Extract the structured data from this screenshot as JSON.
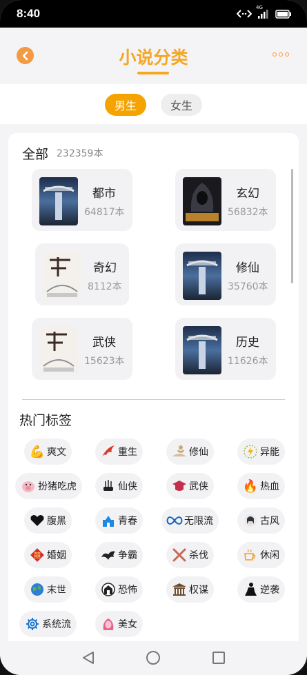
{
  "status_bar": {
    "time": "8:40",
    "network": "4G"
  },
  "header": {
    "title": "小说分类",
    "back_icon": "back-arrow-icon",
    "more_icon": "more-dots-icon"
  },
  "tabs": [
    {
      "label": "男生",
      "active": true
    },
    {
      "label": "女生",
      "active": false
    }
  ],
  "all_section": {
    "title": "全部",
    "count": "232359本"
  },
  "categories": [
    {
      "name": "都市",
      "count": "64817本",
      "cover": "blue-tower"
    },
    {
      "name": "玄幻",
      "count": "56832本",
      "cover": "dark-hooded"
    },
    {
      "name": "奇幻",
      "count": "8112本",
      "cover": "white-ink"
    },
    {
      "name": "修仙",
      "count": "35760本",
      "cover": "blue-tower"
    },
    {
      "name": "武侠",
      "count": "15623本",
      "cover": "white-ink"
    },
    {
      "name": "历史",
      "count": "11626本",
      "cover": "blue-tower"
    }
  ],
  "hot_tags_title": "热门标签",
  "hot_tags": [
    {
      "label": "爽文",
      "icon": "muscle-icon"
    },
    {
      "label": "重生",
      "icon": "phoenix-icon"
    },
    {
      "label": "修仙",
      "icon": "meditation-icon"
    },
    {
      "label": "异能",
      "icon": "energy-icon"
    },
    {
      "label": "扮猪吃虎",
      "icon": "pig-icon"
    },
    {
      "label": "仙侠",
      "icon": "incense-icon"
    },
    {
      "label": "武侠",
      "icon": "scholar-hat-icon"
    },
    {
      "label": "热血",
      "icon": "fire-icon"
    },
    {
      "label": "腹黑",
      "icon": "black-heart-icon"
    },
    {
      "label": "青春",
      "icon": "school-icon"
    },
    {
      "label": "无限流",
      "icon": "infinity-icon"
    },
    {
      "label": "古风",
      "icon": "ancient-figure-icon"
    },
    {
      "label": "婚姻",
      "icon": "double-happiness-icon"
    },
    {
      "label": "争霸",
      "icon": "dragon-icon"
    },
    {
      "label": "杀伐",
      "icon": "crossed-swords-icon"
    },
    {
      "label": "休闲",
      "icon": "coffee-icon"
    },
    {
      "label": "末世",
      "icon": "earth-icon"
    },
    {
      "label": "恐怖",
      "icon": "haunted-house-icon"
    },
    {
      "label": "权谋",
      "icon": "palace-icon"
    },
    {
      "label": "逆袭",
      "icon": "climbing-icon"
    },
    {
      "label": "系统流",
      "icon": "gear-icon"
    },
    {
      "label": "美女",
      "icon": "woman-face-icon"
    }
  ]
}
